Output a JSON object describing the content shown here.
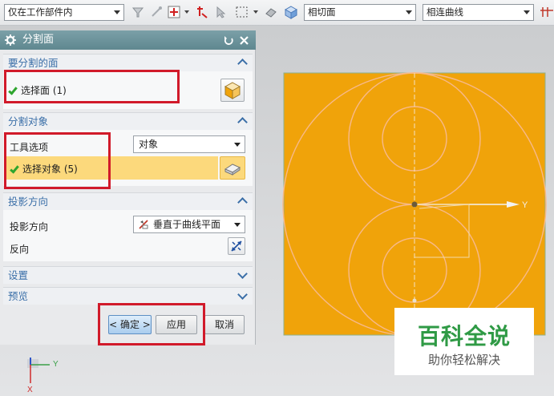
{
  "toolbar": {
    "scope_filter": "仅在工作部件内",
    "face_rule": "相切面",
    "curve_rule": "相连曲线",
    "icons": [
      "filter-icon",
      "snap-icon",
      "view-icon",
      "selection-icon",
      "box-select-icon",
      "solid-icon",
      "cube-icon"
    ]
  },
  "dialog": {
    "title": "分割面",
    "sections": {
      "face_to_split": {
        "header": "要分割的面",
        "select_label": "选择面 (1)"
      },
      "split_object": {
        "header": "分割对象",
        "tool_option_label": "工具选项",
        "tool_option_value": "对象",
        "select_label": "选择对象 (5)"
      },
      "projection": {
        "header": "投影方向",
        "direction_label": "投影方向",
        "direction_value": "垂直于曲线平面",
        "reverse_label": "反向"
      },
      "settings": {
        "header": "设置"
      },
      "preview": {
        "header": "预览"
      }
    },
    "buttons": {
      "ok": "< 确定 >",
      "apply": "应用",
      "cancel": "取消"
    }
  },
  "graphics": {
    "axis_y_label": "Y",
    "triad_y_label": "Y",
    "triad_x_label": "X",
    "face_color": "#f0a30a",
    "curve_color": "#f7b98a"
  },
  "watermark": {
    "title": "百科全说",
    "subtitle": "助你轻松解决"
  }
}
